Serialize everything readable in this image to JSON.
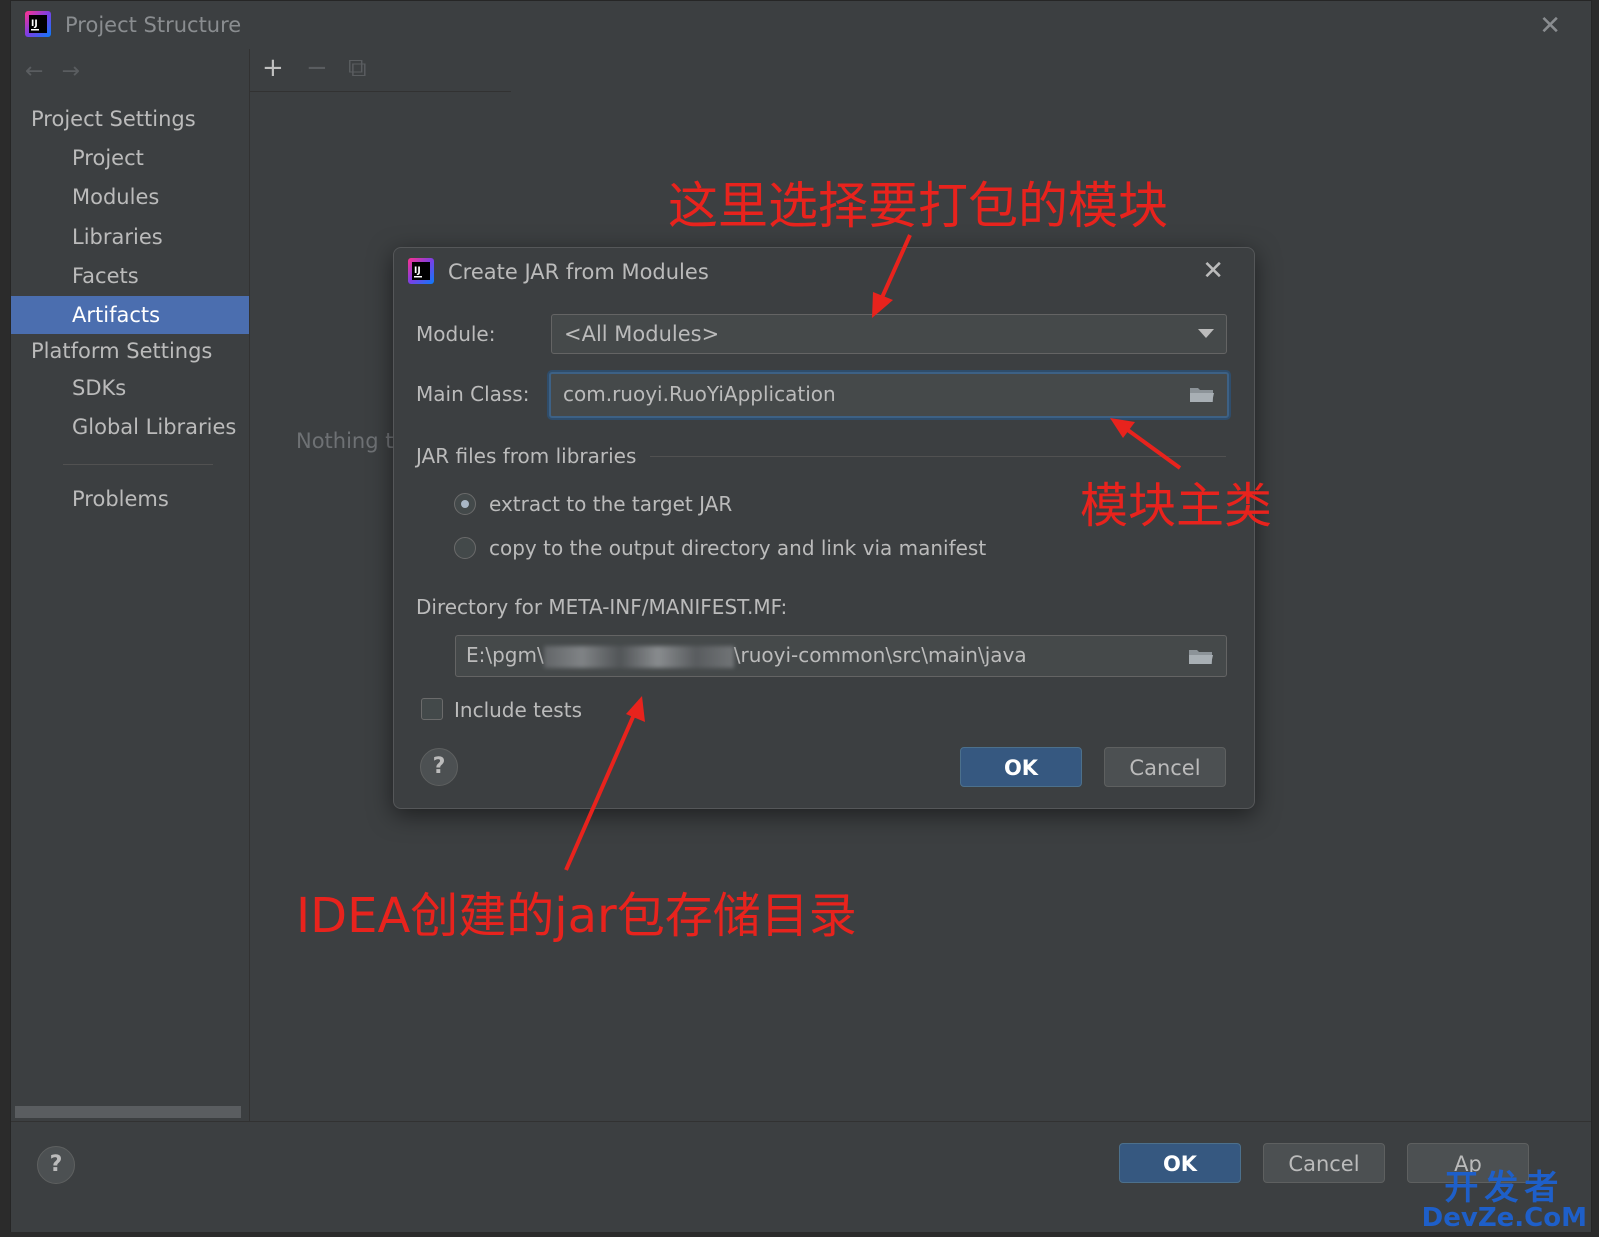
{
  "window": {
    "title": "Project Structure",
    "close_glyph": "✕"
  },
  "sidebar": {
    "nav_back": "←",
    "nav_forward": "→",
    "sections": {
      "project_settings": "Project Settings",
      "platform_settings": "Platform Settings"
    },
    "items": [
      {
        "label": "Project"
      },
      {
        "label": "Modules"
      },
      {
        "label": "Libraries"
      },
      {
        "label": "Facets"
      },
      {
        "label": "Artifacts",
        "selected": true
      },
      {
        "label": "SDKs"
      },
      {
        "label": "Global Libraries"
      },
      {
        "label": "Problems"
      }
    ]
  },
  "middle": {
    "toolbar": {
      "add": "+",
      "remove": "−",
      "copy": "⧉"
    },
    "empty_text": "Nothing to"
  },
  "bottom": {
    "help": "?",
    "ok": "OK",
    "cancel": "Cancel",
    "apply": "Ap"
  },
  "dialog": {
    "title": "Create JAR from Modules",
    "close_glyph": "✕",
    "module_label": "Module:",
    "module_value": "<All Modules>",
    "main_class_label": "Main Class:",
    "main_class_value": "com.ruoyi.RuoYiApplication",
    "jar_group_label": "JAR files from libraries",
    "radio_extract": "extract to the target JAR",
    "radio_copy": "copy to the output directory and link via manifest",
    "radio_selected": "extract",
    "manifest_dir_label": "Directory for META-INF/MANIFEST.MF:",
    "manifest_dir_prefix": "E:\\pgm\\",
    "manifest_dir_suffix": "\\ruoyi-common\\src\\main\\java",
    "include_tests_label": "Include tests",
    "include_tests_checked": false,
    "help": "?",
    "ok": "OK",
    "cancel": "Cancel"
  },
  "annotations": {
    "module_note": "这里选择要打包的模块",
    "main_class_note": "模块主类",
    "dir_note": "IDEA创建的jar包存储目录",
    "color": "#e8231d"
  },
  "watermark": {
    "line1": "开发者",
    "line2": "DevZe.CoM"
  },
  "colors": {
    "selection": "#4b6eaf",
    "primary_button": "#365880",
    "background": "#3c3f41"
  }
}
